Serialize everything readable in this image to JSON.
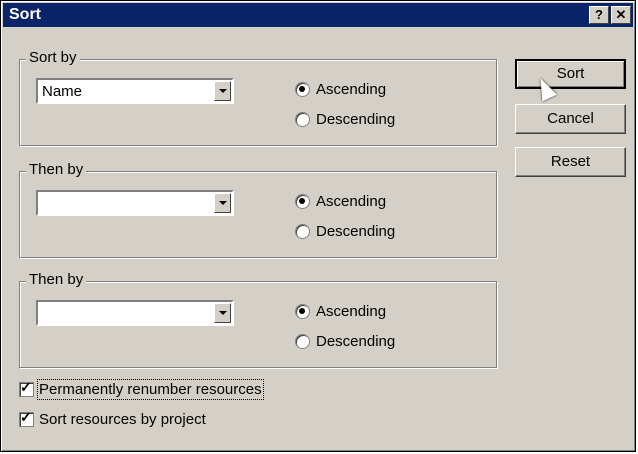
{
  "dialog": {
    "title": "Sort",
    "help_label": "?",
    "close_label": "✕"
  },
  "groups": [
    {
      "legend": "Sort by",
      "combo_value": "Name",
      "asc_label": "Ascending",
      "desc_label": "Descending",
      "selected": "Ascending"
    },
    {
      "legend": "Then by",
      "combo_value": "",
      "asc_label": "Ascending",
      "desc_label": "Descending",
      "selected": "Ascending"
    },
    {
      "legend": "Then by",
      "combo_value": "",
      "asc_label": "Ascending",
      "desc_label": "Descending",
      "selected": "Ascending"
    }
  ],
  "buttons": {
    "sort": "Sort",
    "cancel": "Cancel",
    "reset": "Reset"
  },
  "checkboxes": [
    {
      "label": "Permanently renumber resources",
      "checked": true
    },
    {
      "label": "Sort resources by project",
      "checked": true
    }
  ],
  "icons": {
    "help": "question-mark-icon",
    "close": "close-icon",
    "dropdown": "chevron-down-icon",
    "cursor": "mouse-pointer-icon"
  }
}
